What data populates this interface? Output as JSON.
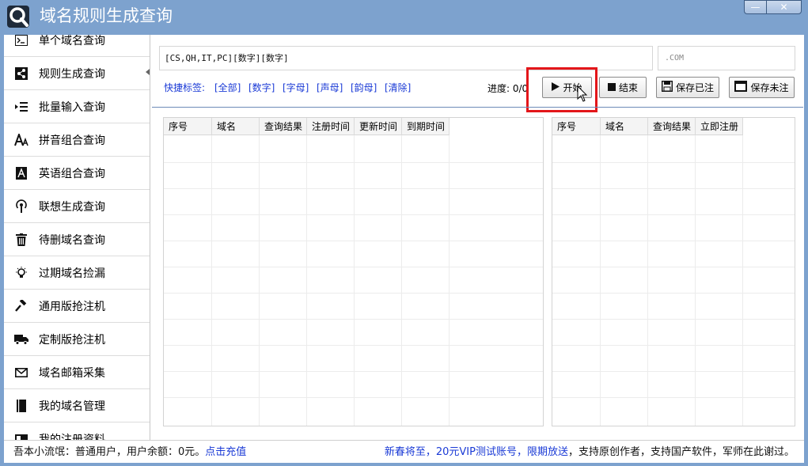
{
  "window": {
    "title": "域名规则生成查询",
    "minimize": "—",
    "close": "✕"
  },
  "sidebar": {
    "items": [
      {
        "label": "单个域名查询",
        "icon": "terminal-icon",
        "glyph": ">_"
      },
      {
        "label": "规则生成查询",
        "icon": "share-icon",
        "glyph": "◩"
      },
      {
        "label": "批量输入查询",
        "icon": "indent-list-icon",
        "glyph": "⇥"
      },
      {
        "label": "拼音组合查询",
        "icon": "font-icon",
        "glyph": "A"
      },
      {
        "label": "英语组合查询",
        "icon": "letter-a-icon",
        "glyph": "▣"
      },
      {
        "label": "联想生成查询",
        "icon": "podcast-icon",
        "glyph": "◉"
      },
      {
        "label": "待删域名查询",
        "icon": "trash-icon",
        "glyph": "▥"
      },
      {
        "label": "过期域名捡漏",
        "icon": "lightbulb-icon",
        "glyph": "◍"
      },
      {
        "label": "通用版抢注机",
        "icon": "gavel-icon",
        "glyph": "⚒"
      },
      {
        "label": "定制版抢注机",
        "icon": "truck-icon",
        "glyph": "▬"
      },
      {
        "label": "域名邮箱采集",
        "icon": "envelope-icon",
        "glyph": "✉"
      },
      {
        "label": "我的域名管理",
        "icon": "book-icon",
        "glyph": "▌"
      },
      {
        "label": "我的注册资料",
        "icon": "card-icon",
        "glyph": "▭"
      }
    ]
  },
  "rule": {
    "value": "[CS,QH,IT,PC][数字][数字]",
    "suffix_placeholder": ".COM"
  },
  "quick": {
    "label": "快捷标签:",
    "tags": [
      "[全部]",
      "[数字]",
      "[字母]",
      "[声母]",
      "[韵母]",
      "[清除]"
    ]
  },
  "progress": {
    "text": "进度: 0/0"
  },
  "toolbar": {
    "start": "开始",
    "stop": "结束",
    "save_registered": "保存已注",
    "save_unregistered": "保存未注"
  },
  "left_table": {
    "columns": [
      "序号",
      "域名",
      "查询结果",
      "注册时间",
      "更新时间",
      "到期时间"
    ]
  },
  "right_table": {
    "columns": [
      "序号",
      "域名",
      "查询结果",
      "立即注册"
    ]
  },
  "status": {
    "user": "吾本小流氓：普通用户，用户余额：0元。",
    "recharge": "点击充值",
    "promo": "新春将至，20元VIP测试账号，限期放送",
    "thanks": "，支持原创作者，支持国产软件，军师在此谢过。"
  },
  "colors": {
    "titlebar": "#7da2ce",
    "link": "#1a3ad6",
    "highlight": "#e3161a"
  }
}
